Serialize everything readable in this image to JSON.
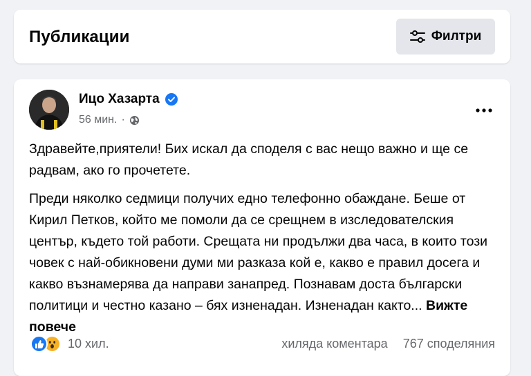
{
  "header": {
    "title": "Публикации",
    "filter_label": "Филтри",
    "filter_icon": "filter-sliders-icon"
  },
  "post": {
    "author": "Ицо Хазарта",
    "verified_icon": "verified-badge-icon",
    "time": "56 мин.",
    "separator": "·",
    "privacy_icon": "globe-icon",
    "more_icon": "more-horizontal-icon",
    "paragraph1": "Здравейте,приятели! Бих искал да споделя с вас нещо важно и ще се радвам, ако го прочетете.",
    "paragraph2": "Преди няколко седмици получих едно телефонно обаждане. Беше от Кирил Петков, който ме помоли да се срещнем в изследователския център, където той работи. Срещата ни продължи два часа, в които този човек с най-обикновени думи ми разказа кой е, какво е правил досега и какво възнамерява да направи занапред. Познавам доста български политици и честно казано – бях изненадан. Изненадан както...",
    "see_more": "Вижте повече",
    "reactions": {
      "icons": [
        "like-icon",
        "wow-icon"
      ],
      "count": "10 хил."
    },
    "comments": "хиляда коментара",
    "shares": "767 споделяния"
  },
  "colors": {
    "background": "#f0f2f5",
    "card": "#ffffff",
    "button": "#e4e6eb",
    "accent": "#1877f2",
    "secondary_text": "#65676b"
  }
}
